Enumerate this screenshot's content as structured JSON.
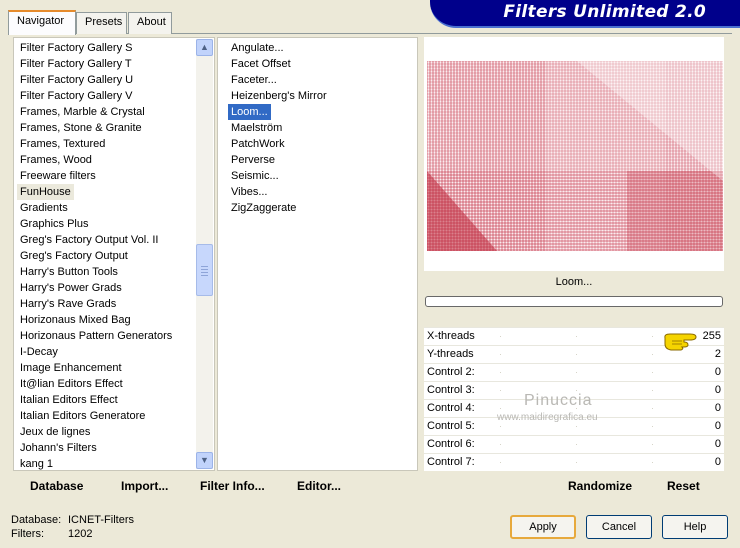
{
  "tabs": [
    "Navigator",
    "Presets",
    "About"
  ],
  "banner_title": "Filters Unlimited 2.0",
  "categories": [
    "Filter Factory Gallery S",
    "Filter Factory Gallery T",
    "Filter Factory Gallery U",
    "Filter Factory Gallery V",
    "Frames, Marble & Crystal",
    "Frames, Stone & Granite",
    "Frames, Textured",
    "Frames, Wood",
    "Freeware filters",
    "FunHouse",
    "Gradients",
    "Graphics Plus",
    "Greg's Factory Output Vol. II",
    "Greg's Factory Output",
    "Harry's Button Tools",
    "Harry's Power Grads",
    "Harry's Rave Grads",
    "Horizonaus Mixed Bag",
    "Horizonaus Pattern Generators",
    "I-Decay",
    "Image Enhancement",
    "It@lian Editors Effect",
    "Italian Editors Effect",
    "Italian Editors Generatore",
    "Jeux de lignes",
    "Johann's Filters",
    "kang 1"
  ],
  "selected_category": "FunHouse",
  "filters": [
    "Angulate...",
    "Facet Offset",
    "Faceter...",
    "Heizenberg's Mirror",
    "Loom...",
    "Maelström",
    "PatchWork",
    "Perverse",
    "Seismic...",
    "Vibes...",
    "ZigZaggerate"
  ],
  "selected_filter": "Loom...",
  "preview_label": "Loom...",
  "controls": [
    {
      "name": "X-threads",
      "value": "255"
    },
    {
      "name": "Y-threads",
      "value": "2"
    },
    {
      "name": "Control 2:",
      "value": "0"
    },
    {
      "name": "Control 3:",
      "value": "0"
    },
    {
      "name": "Control 4:",
      "value": "0"
    },
    {
      "name": "Control 5:",
      "value": "0"
    },
    {
      "name": "Control 6:",
      "value": "0"
    },
    {
      "name": "Control 7:",
      "value": "0"
    }
  ],
  "watermark": {
    "name": "Pinuccia",
    "url": "www.maidiregrafica.eu"
  },
  "toolbar": {
    "database": "Database",
    "import": "Import...",
    "filter_info": "Filter Info...",
    "editor": "Editor...",
    "randomize": "Randomize",
    "reset": "Reset"
  },
  "status": {
    "database_label": "Database:",
    "database_value": "ICNET-Filters",
    "filters_label": "Filters:",
    "filters_value": "1202"
  },
  "buttons": {
    "apply": "Apply",
    "cancel": "Cancel",
    "help": "Help"
  },
  "colors": {
    "banner": "#00008b",
    "selection": "#316ac5",
    "pattern": "#c0283c"
  }
}
